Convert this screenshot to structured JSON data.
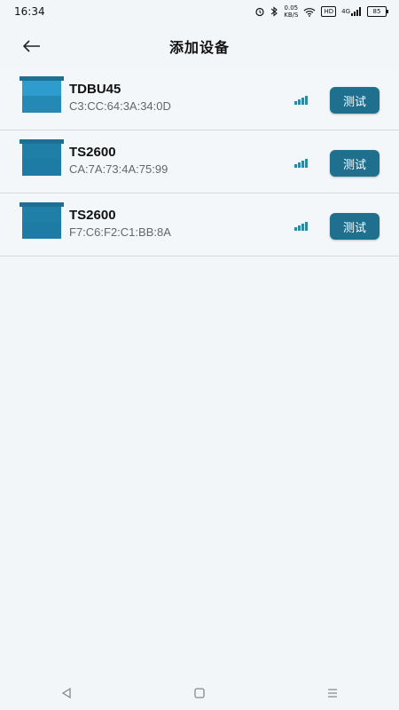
{
  "status_bar": {
    "time": "16:34",
    "net_speed_value": "0.05",
    "net_speed_unit": "KB/S",
    "hd_label": "HD",
    "network_label": "4G",
    "battery_level": "85"
  },
  "header": {
    "title": "添加设备",
    "back_icon": "arrow-left-icon"
  },
  "devices": [
    {
      "name": "TDBU45",
      "mac": "C3:CC:64:3A:34:0D",
      "button_label": "测试",
      "signal_level": 4,
      "thumb_color": "#2e9ccc"
    },
    {
      "name": "TS2600",
      "mac": "CA:7A:73:4A:75:99",
      "button_label": "测试",
      "signal_level": 4,
      "thumb_color": "#1f7fa7"
    },
    {
      "name": "TS2600",
      "mac": "F7:C6:F2:C1:BB:8A",
      "button_label": "测试",
      "signal_level": 4,
      "thumb_color": "#1f7fa7"
    }
  ],
  "nav_bar": {
    "back_icon": "triangle-back-icon",
    "home_icon": "square-home-icon",
    "menu_icon": "menu-lines-icon"
  },
  "colors": {
    "accent": "#1f6f8f",
    "background": "#f3f6f9"
  }
}
